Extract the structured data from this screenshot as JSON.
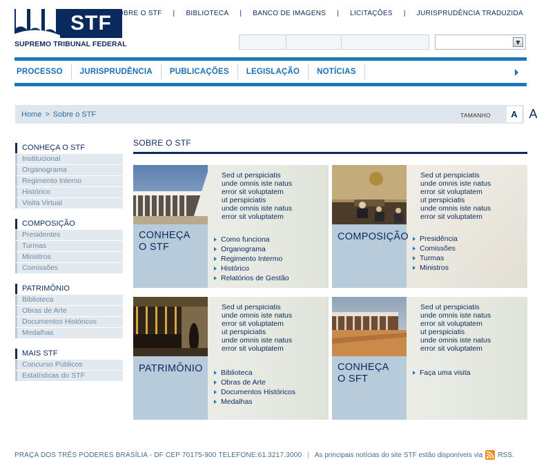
{
  "header": {
    "logo_text": "STF",
    "logo_sub": "SUPREMO TRIBUNAL FEDERAL",
    "top_links": [
      "SOBRE O STF",
      "BIBLIOTECA",
      "BANCO DE IMAGENS",
      "LICITAÇÕES",
      "JURISPRUDÊNCIA TRADUZIDA"
    ],
    "separator": "|"
  },
  "mainnav": {
    "items": [
      "PROCESSO",
      "JURISPRUDÊNCIA",
      "PUBLICAÇÕES",
      "LEGISLAÇÃO",
      "NOTÍCIAS"
    ]
  },
  "breadcrumb": {
    "home": "Home",
    "sep": ">",
    "current": "Sobre o STF",
    "size_label": "TAMANHO",
    "size_small": "A",
    "size_large": "A"
  },
  "sidebar": {
    "groups": [
      {
        "title": "CONHEÇA O STF",
        "items": [
          "Institucional",
          "Organograma",
          "Regimento Interno",
          "Histórico",
          "Visita Virtual"
        ]
      },
      {
        "title": "COMPOSIÇÃO",
        "items": [
          "Presidentes",
          "Turmas",
          "Ministros",
          "Comissões"
        ]
      },
      {
        "title": "PATRIMÔNIO",
        "items": [
          "Biblioteca",
          "Obras de Arte",
          "Documentos Históricos",
          "Medalhas"
        ]
      },
      {
        "title": "MAIS STF",
        "items": [
          "Concurso Públicos",
          "Estatísticas do STF"
        ]
      }
    ]
  },
  "content": {
    "title": "SOBRE O STF",
    "cards": [
      {
        "label_line1": "CONHEÇA",
        "label_line2": "O STF",
        "desc": [
          "Sed ut perspiciatis",
          "unde omnis iste natus",
          "error sit voluptatem",
          "ut perspiciatis",
          "unde omnis iste natus",
          "error sit voluptatem"
        ],
        "links": [
          "Como funciona",
          "Organograma",
          "Regimento Intermo",
          "Histórico",
          "Relatórios de Gestão"
        ]
      },
      {
        "label_line1": "COMPOSIÇÃO",
        "label_line2": "",
        "desc": [
          "Sed ut perspiciatis",
          "unde omnis iste natus",
          "error sit voluptatem",
          "ut perspiciatis",
          "unde omnis iste natus",
          "error sit voluptatem"
        ],
        "links": [
          "Presidência",
          "Comissões",
          "Turmas",
          "Ministros"
        ]
      },
      {
        "label_line1": "PATRIMÔNIO",
        "label_line2": "",
        "desc": [
          "Sed ut perspiciatis",
          "unde omnis iste natus",
          "error sit voluptatem",
          "ut perspiciatis",
          "unde omnis iste natus",
          "error sit voluptatem"
        ],
        "links": [
          "Biblioteca",
          "Obras de Arte",
          "Documentos Históricos",
          "Medalhas"
        ]
      },
      {
        "label_line1": "CONHEÇA",
        "label_line2": "O SFT",
        "desc": [
          "Sed ut perspiciatis",
          "unde omnis iste natus",
          "error sit voluptatem",
          "ut perspiciatis",
          "unde omnis iste natus",
          "error sit voluptatem"
        ],
        "links": [
          "Faça uma visita"
        ]
      }
    ]
  },
  "footer": {
    "address": "PRAÇA DOS TRÊS PODERES BRASÍLIA - DF CEP 70175-900 TELEFONE:61.3217.3000",
    "sep": "|",
    "rss_text": "As principais notícias do site STF estão disponíveis via",
    "rss_label": "RSS."
  },
  "colors": {
    "brand_navy": "#0a2a5e",
    "accent_blue": "#1e78b8",
    "rss_orange": "#f08a20"
  }
}
